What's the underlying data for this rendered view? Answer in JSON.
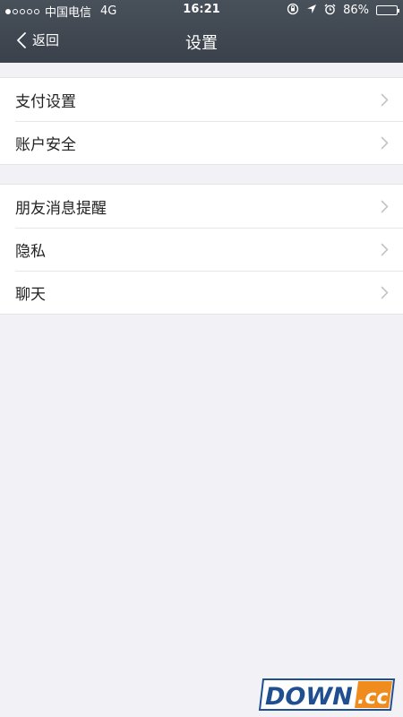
{
  "status_bar": {
    "carrier": "中国电信",
    "network": "4G",
    "time": "16:21",
    "battery_text": "86%",
    "battery_level": 0.86,
    "signal_bars_filled": 1,
    "signal_bars_total": 5,
    "icons": [
      "rotation-lock-icon",
      "location-arrow-icon",
      "alarm-icon",
      "battery-icon"
    ]
  },
  "nav": {
    "back_label": "返回",
    "title": "设置"
  },
  "groups": [
    {
      "items": [
        {
          "label": "支付设置"
        },
        {
          "label": "账户安全"
        }
      ]
    },
    {
      "items": [
        {
          "label": "朋友消息提醒"
        },
        {
          "label": "隐私"
        },
        {
          "label": "聊天"
        }
      ]
    }
  ],
  "watermark": {
    "text_main": "DOWN",
    "text_suffix": ".cc"
  },
  "colors": {
    "header": "#3f464f",
    "background": "#f2f2f6",
    "watermark_blue": "#1f4f91",
    "watermark_orange": "#f08c1e"
  }
}
